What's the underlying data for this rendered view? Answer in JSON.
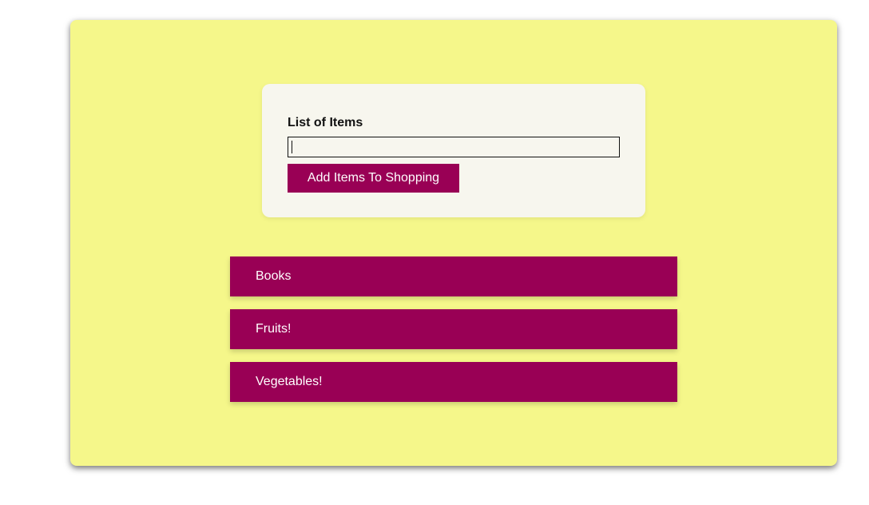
{
  "form": {
    "label": "List of Items",
    "input_value": "",
    "button_label": "Add Items To Shopping"
  },
  "items": [
    {
      "label": "Books"
    },
    {
      "label": "Fruits!"
    },
    {
      "label": "Vegetables!"
    }
  ],
  "colors": {
    "panel_background": "#f5f78a",
    "card_background": "#f7f6ee",
    "accent": "#990055",
    "accent_text": "#ffffff"
  }
}
